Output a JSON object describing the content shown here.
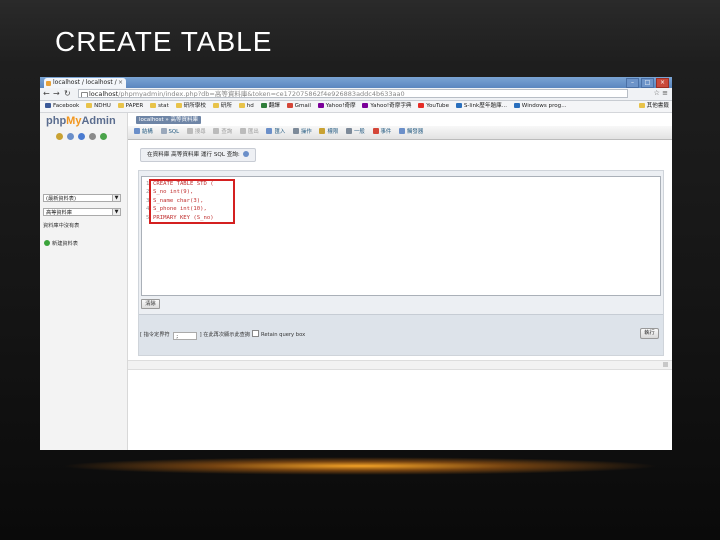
{
  "slide": {
    "title": "CREATE TABLE"
  },
  "browser": {
    "tab_title": "localhost / localhost /",
    "url_host": "localhost",
    "url_rest": "/phpmyadmin/index.php?db=高等資料庫&token=ce172075862f4e926883addc4b633aa0",
    "bookmarks": [
      "Facebook",
      "NDHU",
      "PAPER",
      "stat",
      "研所學校",
      "研所",
      "hd",
      "翻譯",
      "Gmail",
      "Yahoo!奇摩",
      "Yahoo!奇摩字典",
      "YouTube",
      "S-link歷年題庫...",
      "Windows prog..."
    ],
    "bookmark_other": "其他書籤"
  },
  "pma": {
    "logo_php": "php",
    "logo_my": "My",
    "logo_admin": "Admin",
    "server_label": "localhost » 高等資料庫",
    "side_select1": "(最新資料表)",
    "side_select2": "高等資料庫",
    "side_note": "資料庫中沒有表",
    "side_new": "新建資料表",
    "tabs": [
      "結構",
      "SQL",
      "搜尋",
      "查詢",
      "匯出",
      "匯入",
      "操作",
      "權限",
      "一般",
      "事件",
      "觸發器"
    ],
    "sql_heading": "在資料庫 高等資料庫 運行 SQL 查詢:",
    "code_lines": [
      "CREATE TABLE STD (",
      "S_no int(9),",
      "S_name char(3),",
      "S_phone int(10),",
      "PRIMARY KEY (S_no)"
    ],
    "line_numbers": [
      "1",
      "2",
      "3",
      "4",
      "5"
    ],
    "clear_label": "清除",
    "delim_label": "[ 指令定界符",
    "delim_value": ";",
    "rerun_label": "] 在此再次顯示此查詢",
    "retain_label": "Retain query box",
    "go_label": "執行"
  }
}
